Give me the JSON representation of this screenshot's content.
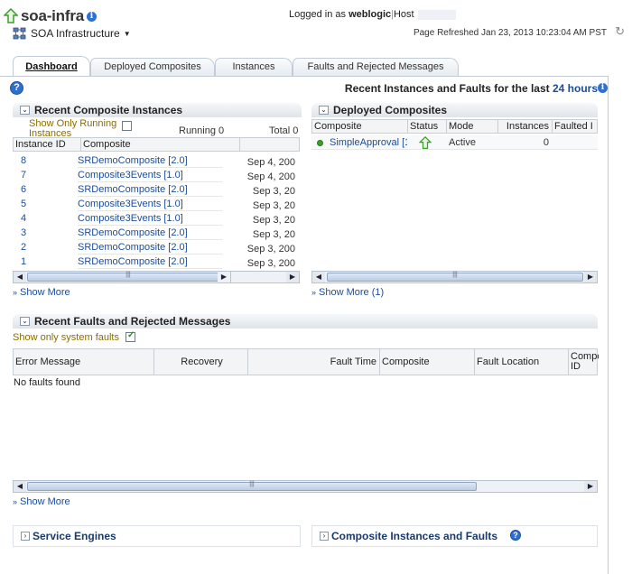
{
  "header": {
    "app_title": "soa-infra",
    "login_prefix": "Logged in as",
    "username": "weblogic",
    "host_label": "Host",
    "infra_menu": "SOA Infrastructure",
    "page_refreshed": "Page Refreshed Jan 23, 2013 10:23:04 AM PST"
  },
  "tabs": [
    {
      "label": "Dashboard",
      "active": true
    },
    {
      "label": "Deployed Composites",
      "active": false
    },
    {
      "label": "Instances",
      "active": false
    },
    {
      "label": "Faults and Rejected Messages",
      "active": false
    }
  ],
  "recent_range": {
    "prefix": "Recent Instances and Faults for the last",
    "value": "24 hours"
  },
  "recent_instances": {
    "title": "Recent Composite Instances",
    "show_running_label": "Show Only Running Instances",
    "running_label": "Running 0",
    "total_label": "Total 0",
    "columns": [
      "Instance ID",
      "Composite"
    ],
    "rows": [
      {
        "id": "8",
        "composite": "SRDemoComposite [2.0]",
        "date": "Sep 4, 200"
      },
      {
        "id": "7",
        "composite": "Composite3Events [1.0]",
        "date": "Sep 4, 200"
      },
      {
        "id": "6",
        "composite": "SRDemoComposite [2.0]",
        "date": "Sep 3, 20"
      },
      {
        "id": "5",
        "composite": "Composite3Events [1.0]",
        "date": "Sep 3, 20"
      },
      {
        "id": "4",
        "composite": "Composite3Events [1.0]",
        "date": "Sep 3, 20"
      },
      {
        "id": "3",
        "composite": "SRDemoComposite [2.0]",
        "date": "Sep 3, 20"
      },
      {
        "id": "2",
        "composite": "SRDemoComposite [2.0]",
        "date": "Sep 3, 200"
      },
      {
        "id": "1",
        "composite": "SRDemoComposite [2.0]",
        "date": "Sep 3, 200"
      }
    ],
    "show_more": "Show More"
  },
  "deployed_composites": {
    "title": "Deployed Composites",
    "columns": [
      "Composite",
      "Status",
      "Mode",
      "Instances",
      "Faulted I"
    ],
    "rows": [
      {
        "composite": "SimpleApproval [1",
        "mode": "Active",
        "instances": "0"
      }
    ],
    "show_more": "Show More (1)"
  },
  "faults": {
    "title": "Recent Faults and Rejected Messages",
    "system_faults_label": "Show only system faults",
    "columns": [
      "Error Message",
      "Recovery",
      "Fault Time",
      "Composite",
      "Fault Location",
      "Compo",
      "ID"
    ],
    "empty_text": "No faults found",
    "show_more": "Show More"
  },
  "service_engines": {
    "title": "Service Engines"
  },
  "composite_faults": {
    "title": "Composite Instances and Faults"
  },
  "colors": {
    "link": "#1a4c9c",
    "accent": "#2f6fd0",
    "up_green": "#3aa02a"
  }
}
